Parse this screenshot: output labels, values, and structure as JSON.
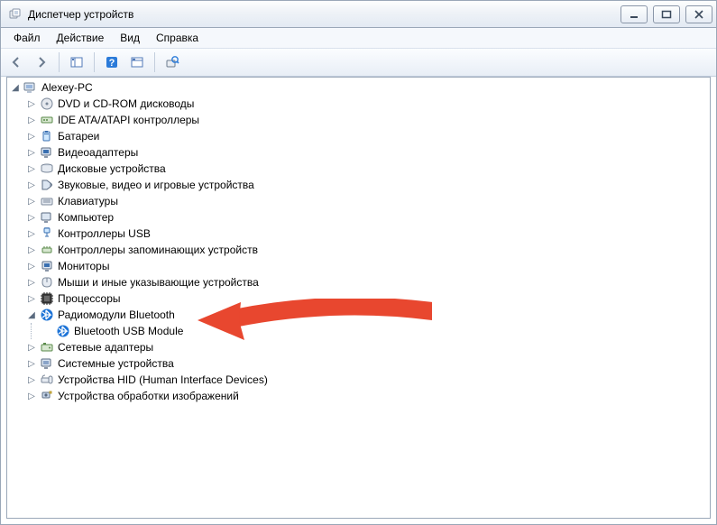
{
  "window": {
    "title": "Диспетчер устройств"
  },
  "menus": {
    "file": "Файл",
    "action": "Действие",
    "view": "Вид",
    "help": "Справка"
  },
  "tree": {
    "root": "Alexey-PC",
    "items": [
      {
        "label": "DVD и CD-ROM дисководы"
      },
      {
        "label": "IDE ATA/ATAPI контроллеры"
      },
      {
        "label": "Батареи"
      },
      {
        "label": "Видеоадаптеры"
      },
      {
        "label": "Дисковые устройства"
      },
      {
        "label": "Звуковые, видео и игровые устройства"
      },
      {
        "label": "Клавиатуры"
      },
      {
        "label": "Компьютер"
      },
      {
        "label": "Контроллеры USB"
      },
      {
        "label": "Контроллеры запоминающих устройств"
      },
      {
        "label": "Мониторы"
      },
      {
        "label": "Мыши и иные указывающие устройства"
      },
      {
        "label": "Процессоры"
      },
      {
        "label": "Радиомодули Bluetooth",
        "expanded": true,
        "child": "Bluetooth USB Module"
      },
      {
        "label": "Сетевые адаптеры"
      },
      {
        "label": "Системные устройства"
      },
      {
        "label": "Устройства HID (Human Interface Devices)"
      },
      {
        "label": "Устройства обработки изображений"
      }
    ]
  }
}
